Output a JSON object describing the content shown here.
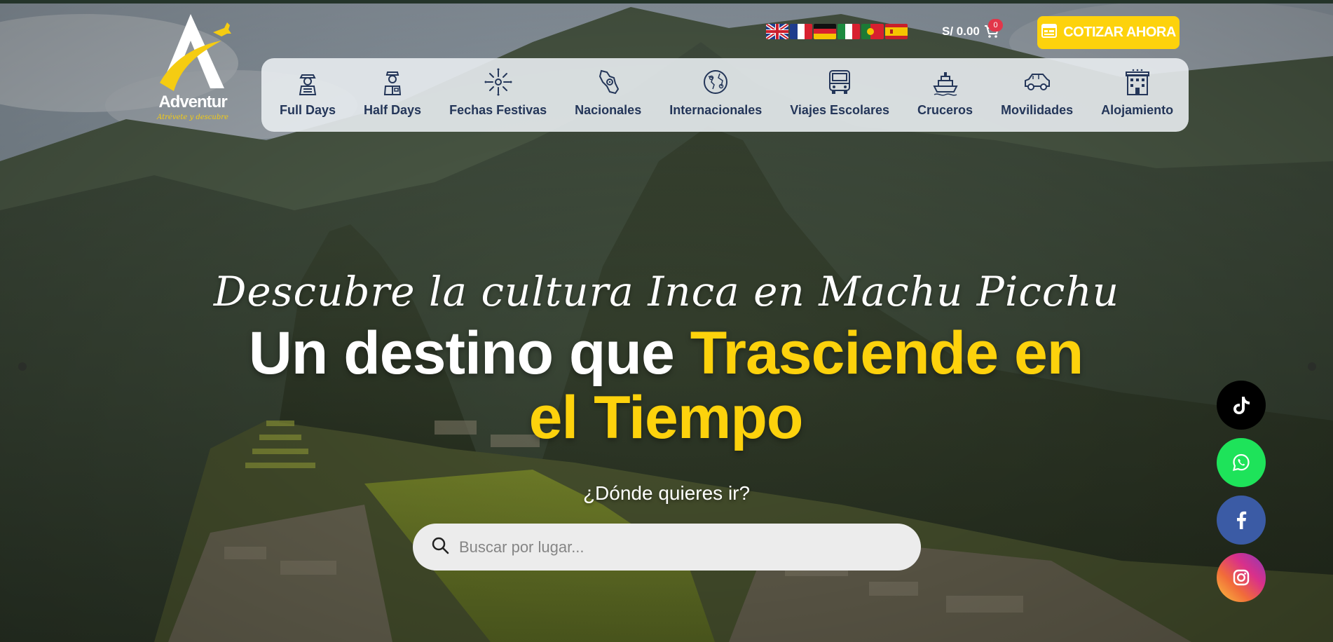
{
  "brand": {
    "name": "Adventur",
    "tagline": "Atrévete y descubre"
  },
  "languages": [
    {
      "code": "en",
      "icon": "flag-uk-icon"
    },
    {
      "code": "fr",
      "icon": "flag-france-icon"
    },
    {
      "code": "de",
      "icon": "flag-germany-icon"
    },
    {
      "code": "it",
      "icon": "flag-italy-icon"
    },
    {
      "code": "pt",
      "icon": "flag-portugal-icon"
    },
    {
      "code": "es",
      "icon": "flag-spain-icon"
    }
  ],
  "cart": {
    "total": "S/ 0.00",
    "count": "0",
    "icon": "cart-icon"
  },
  "quote_button": {
    "label": "COTIZAR AHORA",
    "icon": "quote-form-icon"
  },
  "nav": {
    "items": [
      {
        "label": "Full Days",
        "icon": "explorer-icon"
      },
      {
        "label": "Half Days",
        "icon": "guide-icon"
      },
      {
        "label": "Fechas Festivas",
        "icon": "fireworks-icon"
      },
      {
        "label": "Nacionales",
        "icon": "peru-map-pin-icon"
      },
      {
        "label": "Internacionales",
        "icon": "globe-pins-icon"
      },
      {
        "label": "Viajes Escolares",
        "icon": "school-bus-icon"
      },
      {
        "label": "Cruceros",
        "icon": "cruise-ship-icon"
      },
      {
        "label": "Movilidades",
        "icon": "car-icon"
      },
      {
        "label": "Alojamiento",
        "icon": "hotel-icon"
      }
    ]
  },
  "hero": {
    "script_title": "Descubre la cultura Inca en Machu Picchu",
    "headline_white": "Un destino que ",
    "headline_highlight": "Trasciende en el Tiempo",
    "question": "¿Dónde quieres ir?"
  },
  "search": {
    "placeholder": "Buscar por lugar...",
    "value": "",
    "icon": "search-icon"
  },
  "social": [
    {
      "network": "TikTok",
      "icon": "tiktok-icon"
    },
    {
      "network": "WhatsApp",
      "icon": "whatsapp-icon"
    },
    {
      "network": "Facebook",
      "icon": "facebook-icon"
    },
    {
      "network": "Instagram",
      "icon": "instagram-icon"
    }
  ],
  "colors": {
    "accent_yellow": "#fdd20c",
    "nav_text": "#243659",
    "badge_red": "#e2364a"
  }
}
